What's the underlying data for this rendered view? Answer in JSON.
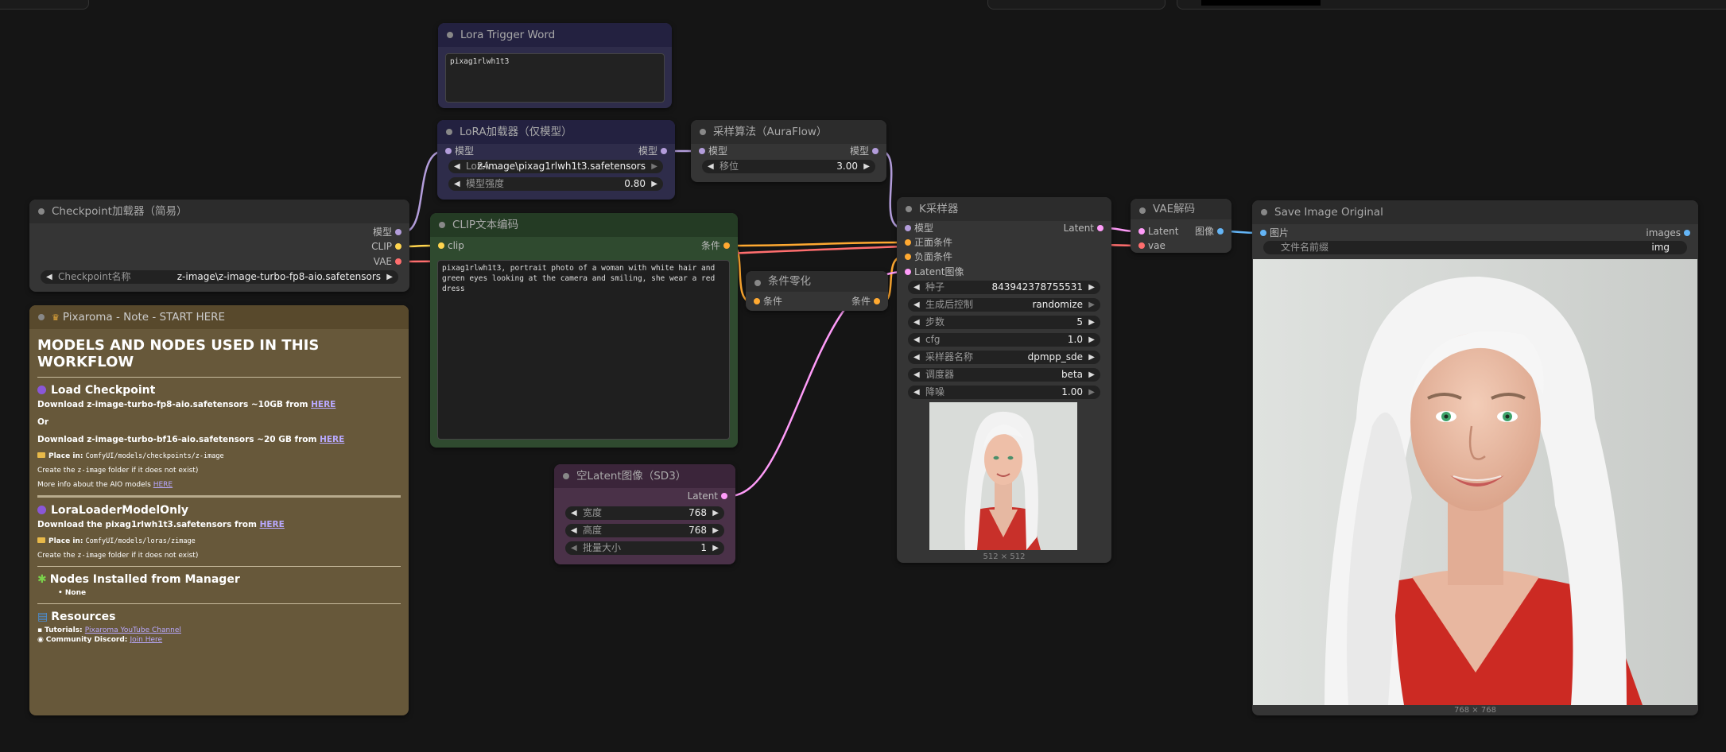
{
  "nodes": {
    "lora_trigger": {
      "title": "Lora Trigger Word",
      "text": "pixag1rlwh1t3"
    },
    "lora_loader": {
      "title": "LoRA加载器（仅模型）",
      "input": "模型",
      "output": "模型",
      "widgets": [
        {
          "label": "LoRA ...",
          "value": "z-image\\pixag1rlwh1t3.safetensors"
        },
        {
          "label": "模型强度",
          "value": "0.80"
        }
      ]
    },
    "sampling_algo": {
      "title": "采样算法（AuraFlow）",
      "input": "模型",
      "output": "模型",
      "widgets": [
        {
          "label": "移位",
          "value": "3.00"
        }
      ]
    },
    "checkpoint": {
      "title": "Checkpoint加载器（简易）",
      "outputs": [
        "模型",
        "CLIP",
        "VAE"
      ],
      "widgets": [
        {
          "label": "Checkpoint名称",
          "value": "z-image\\z-image-turbo-fp8-aio.safetensors"
        }
      ]
    },
    "clip_encode": {
      "title": "CLIP文本编码",
      "input": "clip",
      "output": "条件",
      "text": "pixag1rlwh1t3, portrait photo of a woman with white hair and green eyes looking at the camera and smiling, she wear a red dress"
    },
    "cond_zero": {
      "title": "条件零化",
      "input": "条件",
      "output": "条件"
    },
    "empty_latent": {
      "title": "空Latent图像（SD3）",
      "output": "Latent",
      "widgets": [
        {
          "label": "宽度",
          "value": "768"
        },
        {
          "label": "高度",
          "value": "768"
        },
        {
          "label": "批量大小",
          "value": "1"
        }
      ]
    },
    "ksampler": {
      "title": "K采样器",
      "inputs": [
        "模型",
        "正面条件",
        "负面条件",
        "Latent图像"
      ],
      "output": "Latent",
      "widgets": [
        {
          "label": "种子",
          "value": "843942378755531"
        },
        {
          "label": "生成后控制",
          "value": "randomize"
        },
        {
          "label": "步数",
          "value": "5"
        },
        {
          "label": "cfg",
          "value": "1.0"
        },
        {
          "label": "采样器名称",
          "value": "dpmpp_sde"
        },
        {
          "label": "调度器",
          "value": "beta"
        },
        {
          "label": "降噪",
          "value": "1.00"
        }
      ],
      "preview_size": "512 × 512"
    },
    "vae_decode": {
      "title": "VAE解码",
      "inputs": [
        "Latent",
        "vae"
      ],
      "output": "图像"
    },
    "save_image": {
      "title": "Save Image Original",
      "input": "图片",
      "output": "images",
      "widgets": [
        {
          "label": "文件名前缀",
          "value": "img"
        }
      ],
      "image_size": "768 × 768"
    }
  },
  "note": {
    "title": "Pixaroma - Note - START HERE",
    "heading": "MODELS AND NODES USED IN THIS WORKFLOW",
    "s1_title": "Load Checkpoint",
    "s1_dl1_pre": "Download ",
    "s1_dl1_file": "z-image-turbo-fp8-aio.safetensors",
    "s1_dl1_post": " ~10GB from ",
    "link_here": "HERE",
    "s1_or": "Or",
    "s1_dl2_file": "z-image-turbo-bf16-aio.safetensors",
    "s1_dl2_post": " ~20 GB from ",
    "place_in": "Place in: ",
    "s1_path": "ComfyUI/models/checkpoints/z-image",
    "create_pre": "Create the ",
    "create_code": "z-image",
    "create_post": " folder if it does not exist)",
    "more_info": "More info about the AIO models ",
    "s2_title": "LoraLoaderModelOnly",
    "s2_dl_pre": "Download the ",
    "s2_dl_file": "pixag1rlwh1t3.safetensors",
    "s2_dl_post": " from ",
    "s2_path": "ComfyUI/models/loras/zimage",
    "s3_title": "Nodes Installed from Manager",
    "s3_item": "None",
    "s4_title": "Resources",
    "tutorials_label": "Tutorials: ",
    "tutorials_link": "Pixaroma YouTube Channel",
    "discord_label": "Community Discord: ",
    "discord_link": "Join Here"
  },
  "colors": {
    "model": "#b39ddb",
    "clip": "#ffd54f",
    "vae": "#ff6e6e",
    "conditioning": "#ffa931",
    "latent": "#ff9cf9",
    "image": "#64b5f6",
    "note_bg": "#67583a",
    "clip_node_bg": "#2f4a2f",
    "latent_node_bg": "#4a3148",
    "lora_node_bg": "#2e2c4a"
  }
}
